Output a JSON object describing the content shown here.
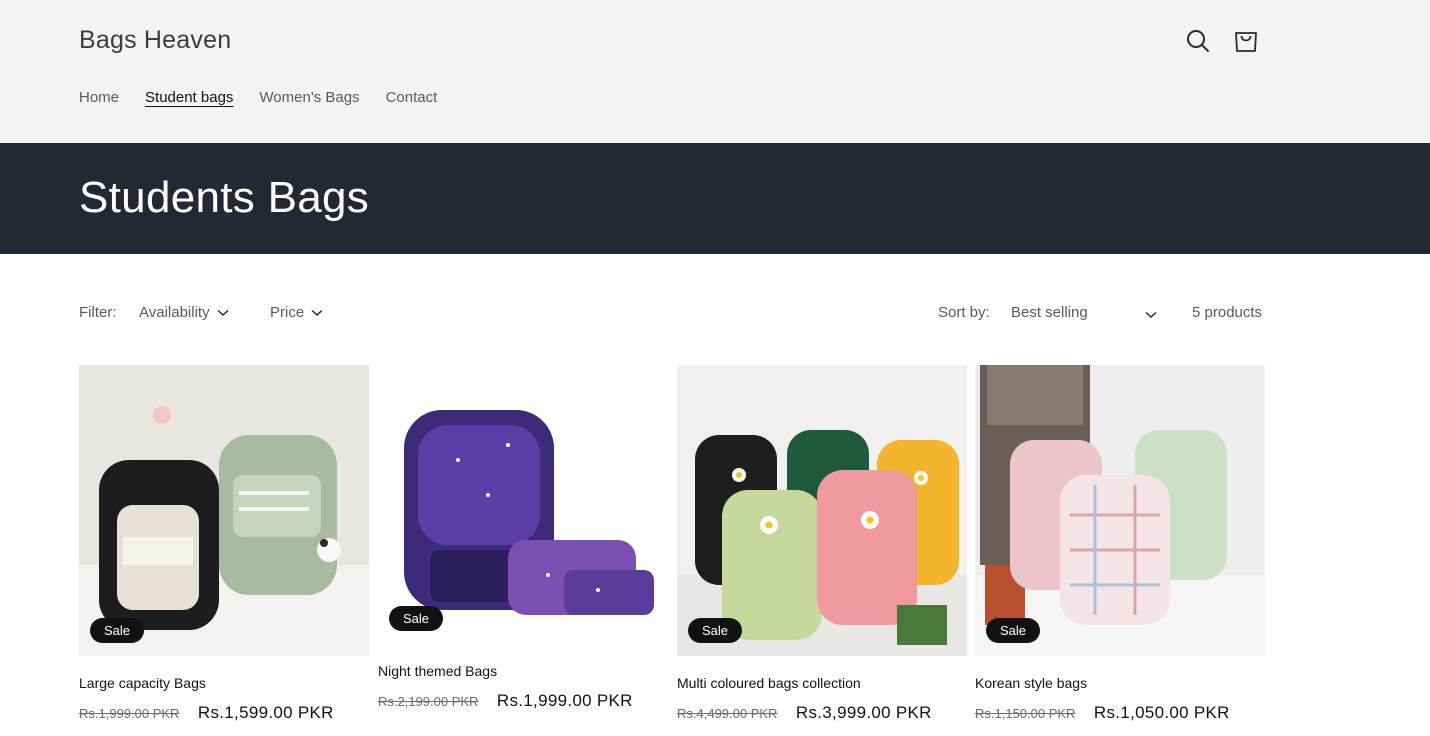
{
  "header": {
    "logo": "Bags Heaven",
    "nav": [
      "Home",
      "Student bags",
      "Women's Bags",
      "Contact"
    ],
    "active_nav": "Student bags"
  },
  "banner": {
    "title": "Students Bags"
  },
  "toolbar": {
    "filter_label": "Filter:",
    "availability": "Availability",
    "price": "Price",
    "sort_label": "Sort by:",
    "sort_value": "Best selling",
    "count": "5 products"
  },
  "products": [
    {
      "title": "Large capacity Bags",
      "old_price": "Rs.1,999.00 PKR",
      "price": "Rs.1,599.00 PKR",
      "badge": "Sale"
    },
    {
      "title": "Night themed Bags",
      "old_price": "Rs.2,199.00 PKR",
      "price": "Rs.1,999.00 PKR",
      "badge": "Sale"
    },
    {
      "title": "Multi coloured bags collection",
      "old_price": "Rs.4,499.00 PKR",
      "price": "Rs.3,999.00 PKR",
      "badge": "Sale"
    },
    {
      "title": "Korean style bags",
      "old_price": "Rs.1,150.00 PKR",
      "price": "Rs.1,050.00 PKR",
      "badge": "Sale"
    }
  ],
  "icons": {
    "search": "search-icon",
    "cart": "cart-icon"
  },
  "colors": {
    "header_bg": "#f3f3f3",
    "banner_bg": "#242833",
    "badge_bg": "#121212"
  }
}
